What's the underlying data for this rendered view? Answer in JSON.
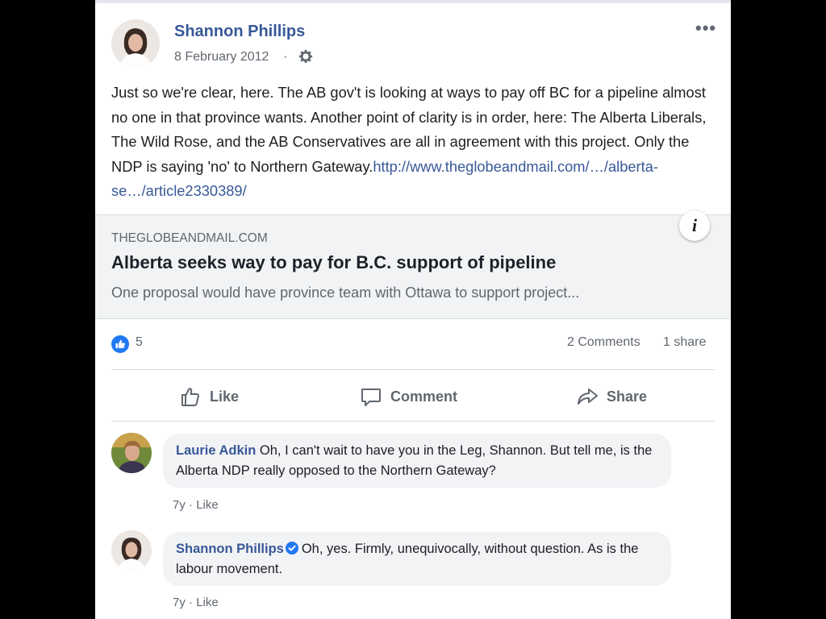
{
  "post": {
    "author": "Shannon Phillips",
    "date": "8 February 2012",
    "date_separator": "·",
    "privacy_icon": "gear-icon",
    "more_label": "•••",
    "text": "Just so we're clear, here. The AB gov't is looking at ways to pay off BC for a pipeline almost no one in that province wants. Another point of clarity is in order, here: The Alberta Liberals, The Wild Rose, and the AB Conservatives are all in agreement with this project. Only the NDP is saying 'no' to Northern Gateway.",
    "link_text": "http://www.theglobeandmail.com/…/alberta-se…/article2330389/"
  },
  "link_preview": {
    "domain": "THEGLOBEANDMAIL.COM",
    "title": "Alberta seeks way to pay for B.C. support of pipeline",
    "description": "One proposal would have province team with Ottawa to support project...",
    "info_label": "i"
  },
  "stats": {
    "likes": "5",
    "comments": "2 Comments",
    "shares": "1 share"
  },
  "actions": {
    "like": "Like",
    "comment": "Comment",
    "share": "Share"
  },
  "comments": [
    {
      "author": "Laurie Adkin",
      "text": "Oh, I can't wait to have you in the Leg, Shannon. But tell me, is the Alberta NDP really opposed to the Northern Gateway?",
      "age": "7y",
      "sep": "·",
      "like": "Like"
    },
    {
      "author": "Shannon Phillips",
      "text": "Oh, yes. Firmly, unequivocally, without question. As is the labour movement.",
      "age": "7y",
      "sep": "·",
      "like": "Like"
    }
  ],
  "colors": {
    "link_blue": "#385898",
    "like_blue": "#2078f4",
    "secondary_text": "#606770"
  }
}
